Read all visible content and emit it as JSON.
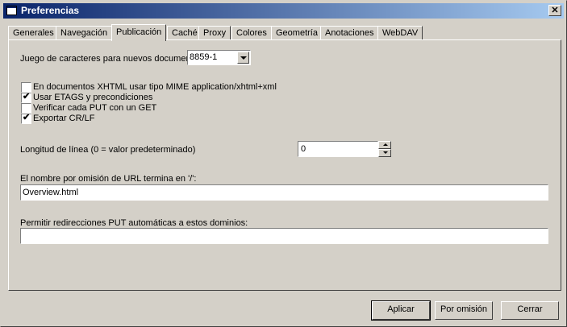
{
  "window": {
    "title": "Preferencias",
    "close_label": "✕"
  },
  "tabs": [
    {
      "label": "Generales"
    },
    {
      "label": "Navegación"
    },
    {
      "label": "Publicación"
    },
    {
      "label": "Caché"
    },
    {
      "label": "Proxy"
    },
    {
      "label": "Colores"
    },
    {
      "label": "Geometría"
    },
    {
      "label": "Anotaciones"
    },
    {
      "label": "WebDAV"
    }
  ],
  "active_tab": "Publicación",
  "charset": {
    "label": "Juego de caracteres para nuevos documentos:",
    "value": "8859-1"
  },
  "checkboxes": [
    {
      "label": "En documentos XHTML usar tipo MIME application/xhtml+xml",
      "checked": false
    },
    {
      "label": "Usar ETAGS y precondiciones",
      "checked": true
    },
    {
      "label": "Verificar cada PUT con un GET",
      "checked": false
    },
    {
      "label": "Exportar CR/LF",
      "checked": true
    }
  ],
  "line_length": {
    "label": "Longitud de línea (0 = valor predeterminado)",
    "value": "0"
  },
  "default_url": {
    "label": "El nombre por omisión de URL termina en '/':",
    "value": "Overview.html"
  },
  "put_redirects": {
    "label": "Permitir redirecciones PUT automáticas a estos dominios:",
    "value": ""
  },
  "buttons": {
    "apply": "Aplicar",
    "default": "Por omisión",
    "close": "Cerrar"
  },
  "check_glyph": "✔"
}
